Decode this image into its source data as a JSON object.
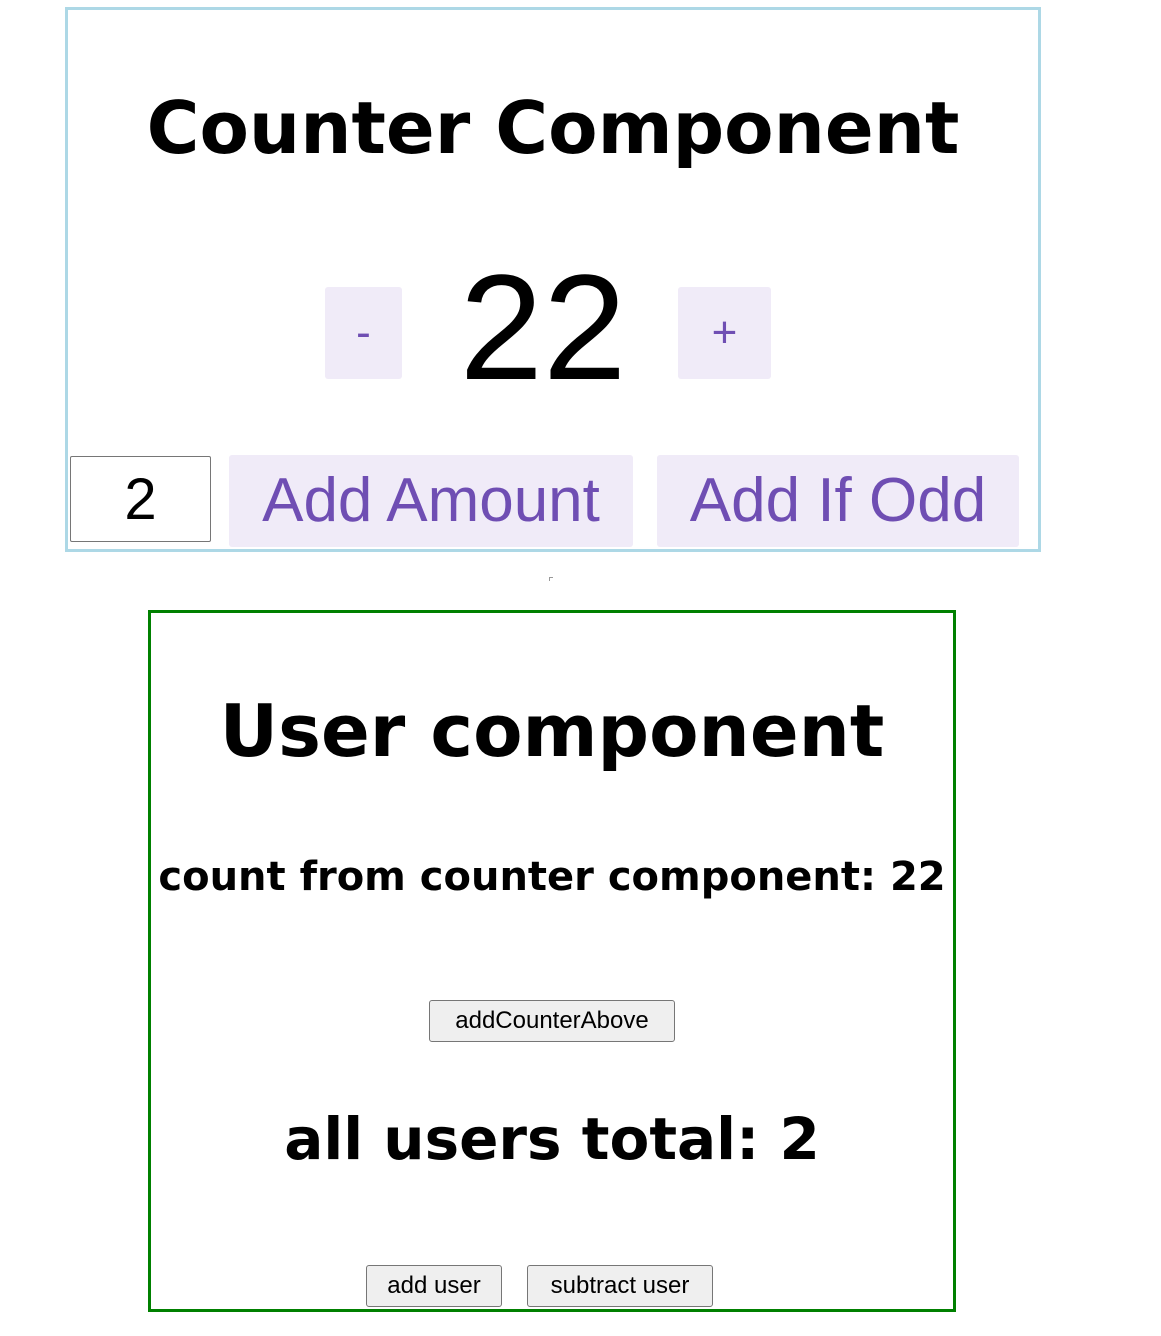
{
  "counter": {
    "title": "Counter Component",
    "decrement_label": "-",
    "increment_label": "+",
    "count": "22",
    "amount_value": "2",
    "add_amount_label": "Add Amount",
    "add_if_odd_label": "Add If Odd",
    "border_color": "#add8e6",
    "button_bg": "#f0ebf8",
    "button_text_color": "#6f4eb3"
  },
  "user": {
    "title": "User component",
    "count_from_counter": "count from counter component: 22",
    "add_counter_above_label": "addCounterAbove",
    "users_total": "all users total: 2",
    "add_user_label": "add user",
    "subtract_user_label": "subtract user",
    "border_color": "#008000"
  }
}
